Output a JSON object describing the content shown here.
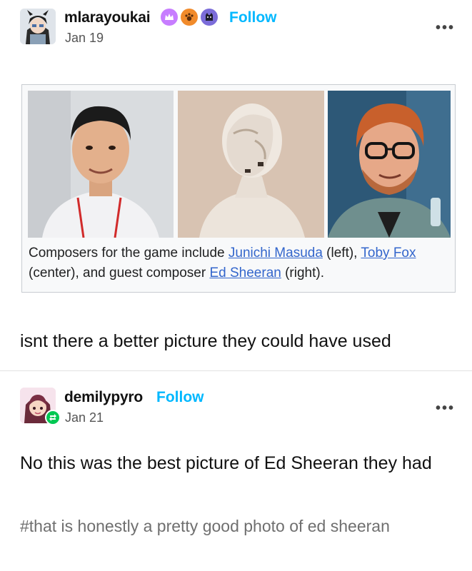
{
  "post1": {
    "username": "mlarayoukai",
    "follow_label": "Follow",
    "date": "Jan 19",
    "more_label": "•••",
    "badges": [
      "purple-crown-badge",
      "orange-paw-badge",
      "purple-cat-badge"
    ],
    "embed": {
      "caption_pre": "Composers for the game include ",
      "link1": "Junichi Masuda",
      "mid1": " (left), ",
      "link2": "Toby Fox",
      "mid2": " (center), and guest composer ",
      "link3": "Ed Sheeran",
      "post": " (right)."
    },
    "text": "isnt there a better picture they could have used"
  },
  "post2": {
    "username": "demilypyro",
    "follow_label": "Follow",
    "date": "Jan 21",
    "more_label": "•••",
    "text": "No this was the best picture of Ed Sheeran they had",
    "tags": "#that is honestly a pretty good photo of ed sheeran"
  },
  "colors": {
    "follow": "#00b8ff",
    "link": "#3366cc",
    "reblog_badge": "#00c853"
  }
}
